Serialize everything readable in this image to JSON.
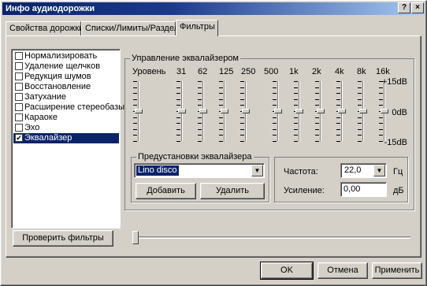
{
  "window": {
    "title": "Инфо аудиодорожки",
    "help_glyph": "?",
    "close_glyph": "×"
  },
  "tabs": [
    {
      "label": "Свойства дорожки",
      "active": false
    },
    {
      "label": "Списки/Лимиты/Разделы",
      "active": false
    },
    {
      "label": "Фильтры",
      "active": true
    }
  ],
  "filters": [
    {
      "label": "Нормализировать",
      "checked": false
    },
    {
      "label": "Удаление щелчков",
      "checked": false
    },
    {
      "label": "Редукция шумов",
      "checked": false
    },
    {
      "label": "Восстановление",
      "checked": false
    },
    {
      "label": "Затухание",
      "checked": false
    },
    {
      "label": "Расширение стереобазы",
      "checked": false
    },
    {
      "label": "Караоке",
      "checked": false
    },
    {
      "label": "Эхо",
      "checked": false
    },
    {
      "label": "Эквалайзер",
      "checked": true,
      "selected": true
    }
  ],
  "equalizer": {
    "group_title": "Управление эквалайзером",
    "bands": [
      "Уровень",
      "31",
      "62",
      "125",
      "250",
      "500",
      "1k",
      "2k",
      "4k",
      "8k",
      "16k"
    ],
    "levels_db": [
      0,
      0,
      0,
      0,
      0,
      0,
      0,
      0,
      0,
      0,
      0
    ],
    "db_max": "+15dB",
    "db_mid": "0dB",
    "db_min": "-15dB"
  },
  "presets": {
    "group_title": "Предустановки эквалайзера",
    "selected": "Lino disco",
    "add_label": "Добавить",
    "delete_label": "Удалить"
  },
  "params": {
    "freq_label": "Частота:",
    "freq_value": "22,0",
    "freq_unit": "Гц",
    "gain_label": "Усиление:",
    "gain_value": "0,00",
    "gain_unit": "дБ"
  },
  "test_button": "Проверить фильтры",
  "test_slider_value": 0,
  "footer": {
    "ok": "OK",
    "cancel": "Отмена",
    "apply": "Применить"
  }
}
